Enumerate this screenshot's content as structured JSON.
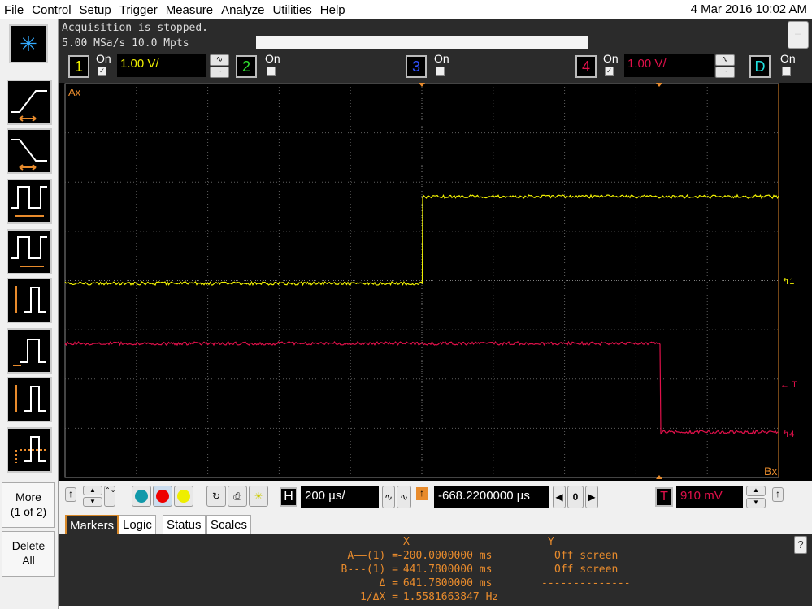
{
  "menu": [
    "File",
    "Control",
    "Setup",
    "Trigger",
    "Measure",
    "Analyze",
    "Utilities",
    "Help"
  ],
  "clock": "4 Mar 2016 10:02 AM",
  "status": {
    "line1": "Acquisition is stopped.",
    "line2": "5.00 MSa/s   10.0 Mpts"
  },
  "channels": [
    {
      "num": "1",
      "on_label": "On",
      "checked": true,
      "scale": "1.00 V/",
      "color": "#f0f000"
    },
    {
      "num": "2",
      "on_label": "On",
      "checked": false,
      "color": "#30e030"
    },
    {
      "num": "3",
      "on_label": "On",
      "checked": false,
      "color": "#3050ff"
    },
    {
      "num": "4",
      "on_label": "On",
      "checked": true,
      "scale": "1.00 V/",
      "color": "#e0104a"
    },
    {
      "num": "D",
      "on_label": "On",
      "checked": false,
      "color": "#20e0e0"
    }
  ],
  "screen": {
    "marker_a_label": "Ax",
    "marker_b_label": "Bx",
    "ch1_marker": "1",
    "ch4_marker": "4",
    "trig_marker": "T"
  },
  "sidebar": {
    "more": "More",
    "more_page": "(1 of 2)",
    "delete": "Delete",
    "delete2": "All"
  },
  "horizontal": {
    "label": "H",
    "scale": "200 µs/",
    "delay": "-668.2200000 µs",
    "zero": "0"
  },
  "trigger": {
    "label": "T",
    "level": "910 mV"
  },
  "tabs": [
    "Markers",
    "Logic",
    "Status",
    "Scales"
  ],
  "markers": {
    "x_header": "X",
    "y_header": "Y",
    "rows": [
      {
        "label": "A——(1) =",
        "x": "-200.0000000 ms",
        "y": "Off screen"
      },
      {
        "label": "B---(1) =",
        "x": " 441.7800000 ms",
        "y": "Off screen"
      },
      {
        "label": "Δ =",
        "x": " 641.7800000 ms",
        "y": "--------------"
      },
      {
        "label": "1/ΔX =",
        "x": " 1.5581663847 Hz",
        "y": ""
      }
    ]
  },
  "colors": {
    "ch1": "#f0f000",
    "ch4": "#e0104a",
    "marker": "#e88b2c",
    "grid": "#606060"
  }
}
